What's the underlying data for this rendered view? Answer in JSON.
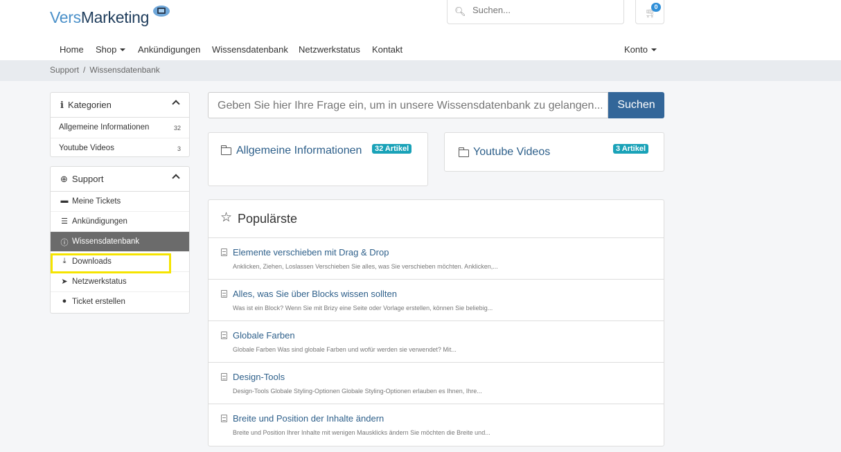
{
  "header": {
    "logo_part1": "Vers",
    "logo_part2": "Marketing",
    "search_placeholder": "Suchen...",
    "cart_count": "0"
  },
  "nav": {
    "items": [
      "Home",
      "Shop",
      "Ankündigungen",
      "Wissensdatenbank",
      "Netzwerkstatus",
      "Kontakt"
    ],
    "account": "Konto"
  },
  "breadcrumb": {
    "items": [
      "Support",
      "Wissensdatenbank"
    ],
    "separator": "/"
  },
  "sidebar": {
    "categories": {
      "title": "Kategorien",
      "items": [
        {
          "label": "Allgemeine Informationen",
          "count": "32"
        },
        {
          "label": "Youtube Videos",
          "count": "3"
        }
      ]
    },
    "support": {
      "title": "Support",
      "items": [
        {
          "label": "Meine Tickets",
          "icon": "ticket-icon"
        },
        {
          "label": "Ankündigungen",
          "icon": "list-icon"
        },
        {
          "label": "Wissensdatenbank",
          "icon": "info-icon"
        },
        {
          "label": "Downloads",
          "icon": "download-icon"
        },
        {
          "label": "Netzwerkstatus",
          "icon": "rocket-icon"
        },
        {
          "label": "Ticket erstellen",
          "icon": "comments-icon"
        }
      ]
    }
  },
  "kb_search": {
    "placeholder": "Geben Sie hier Ihre Frage ein, um in unsere Wissensdatenbank zu gelangen...",
    "button": "Suchen"
  },
  "categories": [
    {
      "title": "Allgemeine Informationen",
      "badge": "32 Artikel"
    },
    {
      "title": "Youtube Videos",
      "badge": "3 Artikel"
    }
  ],
  "popular": {
    "title": "Populärste",
    "items": [
      {
        "title": "Elemente verschieben mit Drag & Drop",
        "desc": "Anklicken, Ziehen, Loslassen Verschieben Sie alles, was Sie verschieben möchten. Anklicken,..."
      },
      {
        "title": "Alles, was Sie über Blocks wissen sollten",
        "desc": "Was ist ein Block? Wenn Sie mit Brizy eine Seite oder Vorlage erstellen, können Sie beliebig..."
      },
      {
        "title": "Globale Farben",
        "desc": "Globale Farben Was sind globale Farben und wofür werden sie verwendet? Mit..."
      },
      {
        "title": "Design-Tools",
        "desc": "Design-Tools  Globale Styling-Optionen Globale Styling-Optionen erlauben es Ihnen, Ihre..."
      },
      {
        "title": "Breite und Position der Inhalte ändern",
        "desc": "Breite und Position Ihrer Inhalte mit wenigen Mausklicks ändern Sie möchten die Breite und..."
      }
    ]
  },
  "colors": {
    "accent": "#336699",
    "badge": "#19a2b8",
    "active_item": "#6b6b6b",
    "highlight": "#f5e400",
    "link": "#2d5f8a"
  }
}
